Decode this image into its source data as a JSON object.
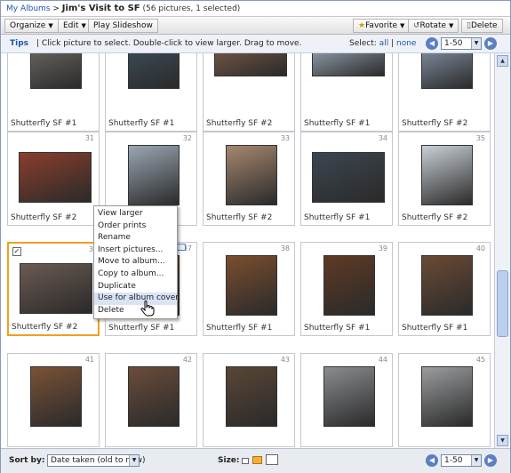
{
  "breadcrumb": {
    "root": "My Albums",
    "sep": ">",
    "album": "Jim's Visit to SF",
    "count": "(56 pictures, 1 selected)"
  },
  "toolbar": {
    "organize": "Organize",
    "edit": "Edit",
    "slideshow": "Play Slideshow",
    "favorite": "Favorite",
    "rotate": "Rotate",
    "delete": "Delete",
    "icons": {
      "favorite": "star-icon",
      "rotate": "rotate-icon",
      "delete": "trash-icon"
    }
  },
  "tips": {
    "label": "Tips",
    "text": "| Click picture to select. Double-click to view larger. Drag to move.",
    "select_label": "Select:",
    "all": "all",
    "bar": "|",
    "none": "none",
    "range": "1-50"
  },
  "rows": [
    [
      {
        "caption": "Shutterfly SF #1"
      },
      {
        "caption": "Shutterfly SF #1"
      },
      {
        "caption": "Shutterfly SF #2"
      },
      {
        "caption": "Shutterfly SF #1"
      },
      {
        "caption": "Shutterfly SF #2"
      }
    ],
    [
      {
        "num": "31",
        "caption": "Shutterfly SF #2"
      },
      {
        "num": "32",
        "caption": ""
      },
      {
        "num": "33",
        "caption": "Shutterfly SF #2"
      },
      {
        "num": "34",
        "caption": "Shutterfly SF #1"
      },
      {
        "num": "35",
        "caption": "Shutterfly SF #2"
      }
    ],
    [
      {
        "num": "3",
        "caption": "Shutterfly SF #2",
        "selected": true
      },
      {
        "num": "37",
        "caption": "Shutterfly SF #1"
      },
      {
        "num": "38",
        "caption": "Shutterfly SF #1"
      },
      {
        "num": "39",
        "caption": "Shutterfly SF #1"
      },
      {
        "num": "40",
        "caption": "Shutterfly SF #1"
      }
    ],
    [
      {
        "num": "41",
        "caption": ""
      },
      {
        "num": "42",
        "caption": ""
      },
      {
        "num": "43",
        "caption": ""
      },
      {
        "num": "44",
        "caption": ""
      },
      {
        "num": "45",
        "caption": ""
      }
    ]
  ],
  "menu": {
    "items": [
      "View larger",
      "Order prints",
      "Rename",
      "Insert pictures...",
      "Move to album...",
      "Copy to album...",
      "Duplicate",
      "Use for album cover",
      "Delete"
    ],
    "highlighted": 7
  },
  "bottom": {
    "sort_label": "Sort by:",
    "sort_value": "Date taken (old to new)",
    "size_label": "Size:",
    "range": "1-50"
  },
  "colors": {
    "selected_border": "#f0a020",
    "link": "#2255aa",
    "menu_highlight": "#d8e4f6"
  }
}
